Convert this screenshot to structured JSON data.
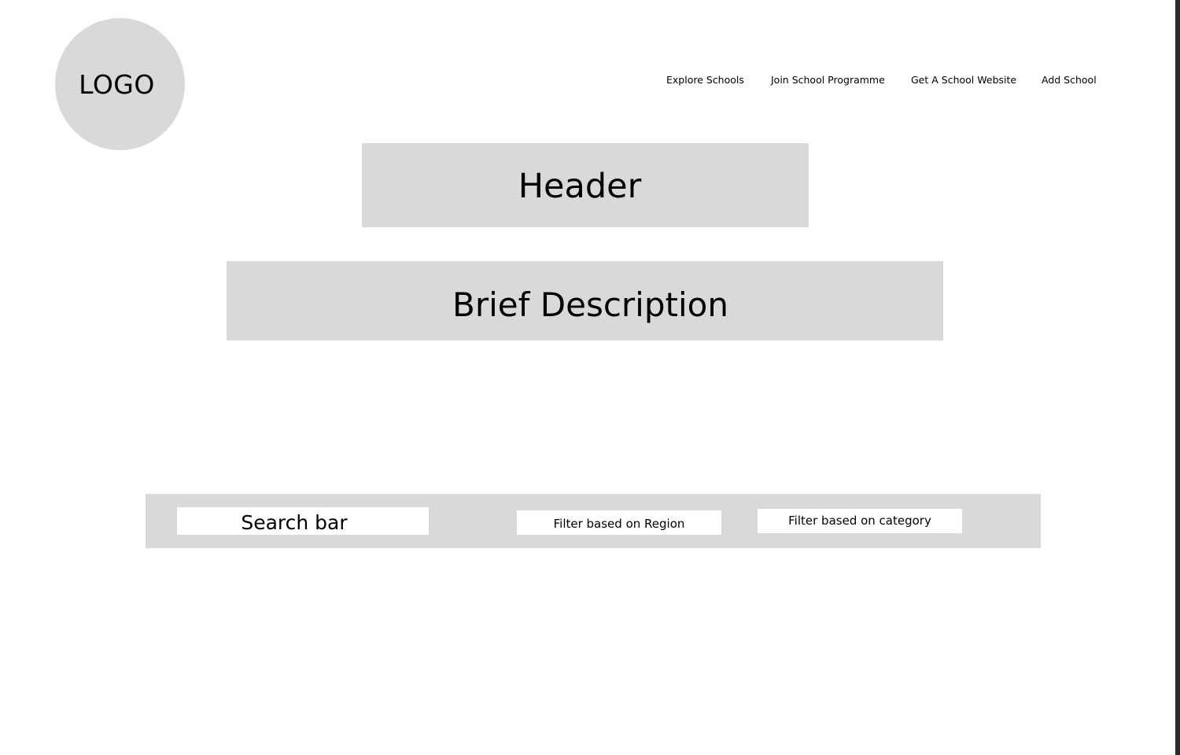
{
  "logo": {
    "text": "LOGO"
  },
  "nav": {
    "items": [
      {
        "label": "Explore Schools"
      },
      {
        "label": "Join School Programme"
      },
      {
        "label": "Get A School Website"
      },
      {
        "label": "Add School"
      }
    ]
  },
  "hero": {
    "header": "Header",
    "description": "Brief Description"
  },
  "search_toolbar": {
    "search_placeholder": "Search bar",
    "filter_region_label": "Filter based on Region",
    "filter_category_label": "Filter based on category"
  },
  "colors": {
    "placeholder_fill": "#d9d9d9",
    "background": "#ffffff",
    "text": "#000000"
  }
}
